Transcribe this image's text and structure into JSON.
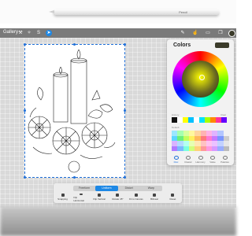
{
  "pencil": {
    "brand": "Pencil"
  },
  "toolbar": {
    "gallery_label": "Gallery",
    "left_icons": [
      "wrench-icon",
      "magic-wand-icon",
      "selection-icon",
      "transform-arrow-icon"
    ],
    "right_icons": [
      "brush-icon",
      "smudge-icon",
      "eraser-icon",
      "layers-icon"
    ]
  },
  "colors_panel": {
    "title": "Colors",
    "current_color": "#3b3b2a",
    "history_label": "History",
    "clear_label": "Clear",
    "default_palette_label": "Default",
    "tabs": [
      "Disc",
      "Classic",
      "Harmony",
      "Value",
      "Palettes"
    ],
    "active_tab": "Disc",
    "history_colors": [
      "#111111",
      "#ffffff",
      "#ffff00",
      "#00c0ff",
      "#ffffff",
      "#00e0ff",
      "#aaff00",
      "#ff8800",
      "#ff3399",
      "#6600ff"
    ]
  },
  "transform": {
    "modes": [
      "Freeform",
      "Uniform",
      "Distort",
      "Warp"
    ],
    "active_mode": "Uniform",
    "actions": [
      "Snapping",
      "Flip Horizontal",
      "Flip Vertical",
      "Rotate 45°",
      "Fit to Canvas",
      "Bilinear",
      "Reset"
    ]
  },
  "accent_color": "#1e88e5"
}
